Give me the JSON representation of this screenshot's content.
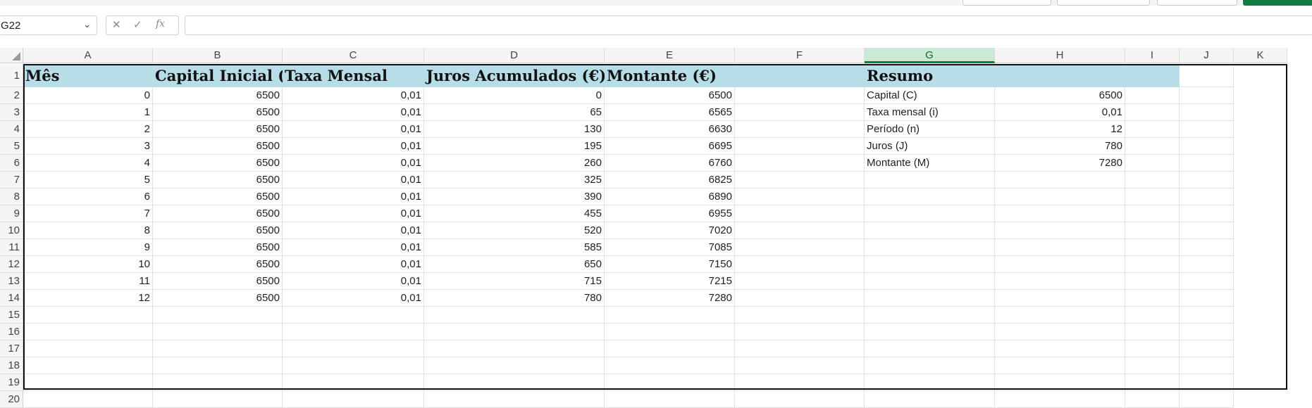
{
  "name_box": {
    "value": "G22"
  },
  "formula_bar": {
    "cancel_icon": "✕",
    "enter_icon": "✓",
    "fx_label": "fx",
    "formula": ""
  },
  "columns": [
    "A",
    "B",
    "C",
    "D",
    "E",
    "F",
    "G",
    "H",
    "I",
    "J",
    "K"
  ],
  "active_column": "G",
  "rows": [
    "1",
    "2",
    "3",
    "4",
    "5",
    "6",
    "7",
    "8",
    "9",
    "10",
    "11",
    "12",
    "13",
    "14",
    "15",
    "16",
    "17",
    "18",
    "19",
    "20"
  ],
  "headers": {
    "A1": "Mês",
    "B1": "Capital Inicial (€",
    "C1": "Taxa Mensal",
    "D1": "Juros Acumulados (€)",
    "E1": "Montante (€)",
    "G1": "Resumo"
  },
  "table": [
    {
      "mes": "0",
      "capital": "6500",
      "taxa": "0,01",
      "juros": "0",
      "montante": "6500"
    },
    {
      "mes": "1",
      "capital": "6500",
      "taxa": "0,01",
      "juros": "65",
      "montante": "6565"
    },
    {
      "mes": "2",
      "capital": "6500",
      "taxa": "0,01",
      "juros": "130",
      "montante": "6630"
    },
    {
      "mes": "3",
      "capital": "6500",
      "taxa": "0,01",
      "juros": "195",
      "montante": "6695"
    },
    {
      "mes": "4",
      "capital": "6500",
      "taxa": "0,01",
      "juros": "260",
      "montante": "6760"
    },
    {
      "mes": "5",
      "capital": "6500",
      "taxa": "0,01",
      "juros": "325",
      "montante": "6825"
    },
    {
      "mes": "6",
      "capital": "6500",
      "taxa": "0,01",
      "juros": "390",
      "montante": "6890"
    },
    {
      "mes": "7",
      "capital": "6500",
      "taxa": "0,01",
      "juros": "455",
      "montante": "6955"
    },
    {
      "mes": "8",
      "capital": "6500",
      "taxa": "0,01",
      "juros": "520",
      "montante": "7020"
    },
    {
      "mes": "9",
      "capital": "6500",
      "taxa": "0,01",
      "juros": "585",
      "montante": "7085"
    },
    {
      "mes": "10",
      "capital": "6500",
      "taxa": "0,01",
      "juros": "650",
      "montante": "7150"
    },
    {
      "mes": "11",
      "capital": "6500",
      "taxa": "0,01",
      "juros": "715",
      "montante": "7215"
    },
    {
      "mes": "12",
      "capital": "6500",
      "taxa": "0,01",
      "juros": "780",
      "montante": "7280"
    }
  ],
  "resumo": [
    {
      "label": "Capital (C)",
      "value": "6500"
    },
    {
      "label": "Taxa mensal (i)",
      "value": "0,01"
    },
    {
      "label": "Período (n)",
      "value": "12"
    },
    {
      "label": "Juros (J)",
      "value": "780"
    },
    {
      "label": "Montante (M)",
      "value": "7280"
    }
  ],
  "colors": {
    "header_fill": "#b7dde8",
    "active_column": "#caead6",
    "accent": "#107c41"
  }
}
